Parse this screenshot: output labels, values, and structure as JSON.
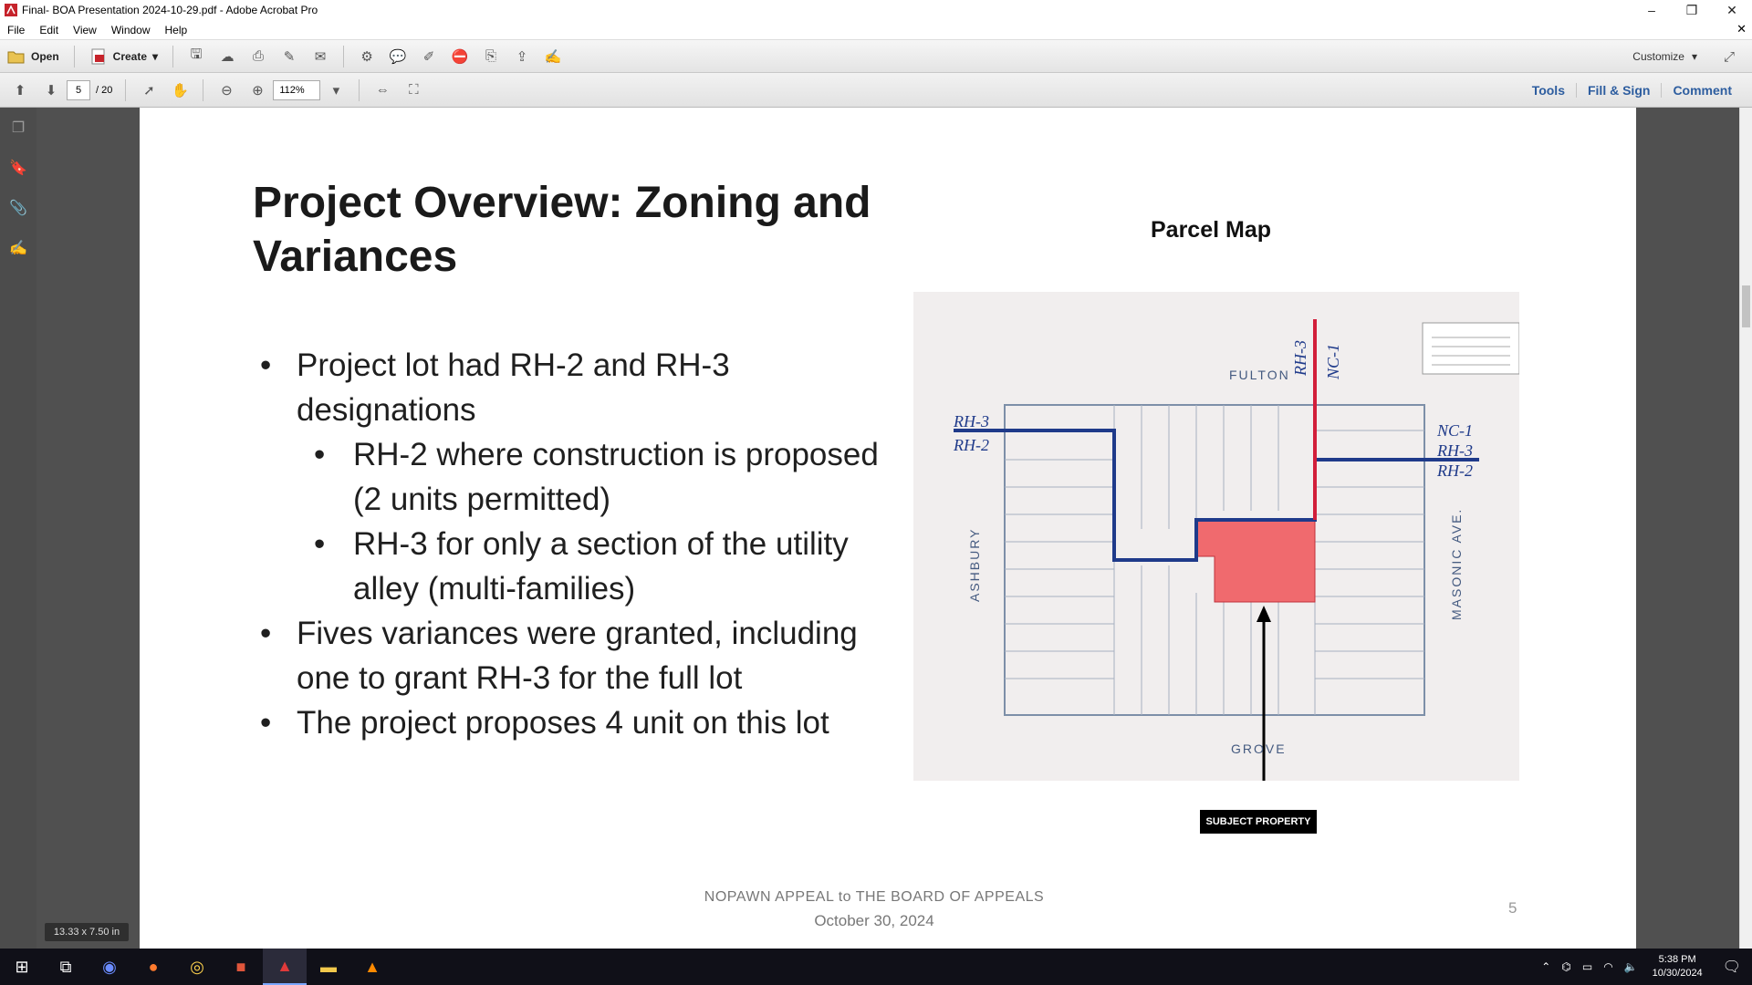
{
  "window": {
    "title": "Final- BOA Presentation 2024-10-29.pdf - Adobe Acrobat Pro",
    "minimize": "–",
    "restore": "❐",
    "close": "✕"
  },
  "menu": [
    "File",
    "Edit",
    "View",
    "Window",
    "Help"
  ],
  "toolbar": {
    "open_label": "Open",
    "create_label": "Create",
    "customize_label": "Customize"
  },
  "nav": {
    "current_page": "5",
    "total_pages": "/ 20",
    "zoom": "112%"
  },
  "right_links": [
    "Tools",
    "Fill & Sign",
    "Comment"
  ],
  "slide": {
    "title": "Project Overview: Zoning and Variances",
    "bullets": [
      {
        "text": "Project lot had RH-2 and RH-3 designations",
        "level": 1
      },
      {
        "text": "RH-2 where construction is proposed (2 units permitted)",
        "level": 2
      },
      {
        "text": "RH-3 for only a section of the utility alley (multi-families)",
        "level": 2
      },
      {
        "text": "Fives variances were granted, including one to grant RH-3 for the full lot",
        "level": 1
      },
      {
        "text": "The project proposes 4 unit on this lot",
        "level": 1
      }
    ],
    "map_title": "Parcel Map",
    "map_labels": {
      "north_street": "FULTON",
      "south_street": "GROVE",
      "west_street": "ASHBURY",
      "east_street": "MASONIC AVE.",
      "zone_rh3_left": "RH-3",
      "zone_rh2_left": "RH-2",
      "zone_nc1_right": "NC-1",
      "zone_rh3_right": "RH-3",
      "zone_rh2_right": "RH-2",
      "zone_rh3_top": "RH-3",
      "zone_nc1_top": "NC-1",
      "subject": "SUBJECT PROPERTY"
    },
    "footer_line1": "NOPAWN APPEAL to THE BOARD OF APPEALS",
    "footer_line2": "October 30, 2024",
    "page_number": "5"
  },
  "size_badge": "13.33 x 7.50 in",
  "clock": {
    "time": "5:38 PM",
    "date": "10/30/2024"
  },
  "colors": {
    "subject_fill": "#f06a6e",
    "zone_line": "#1f3a8a",
    "red_line": "#d21e3a"
  }
}
